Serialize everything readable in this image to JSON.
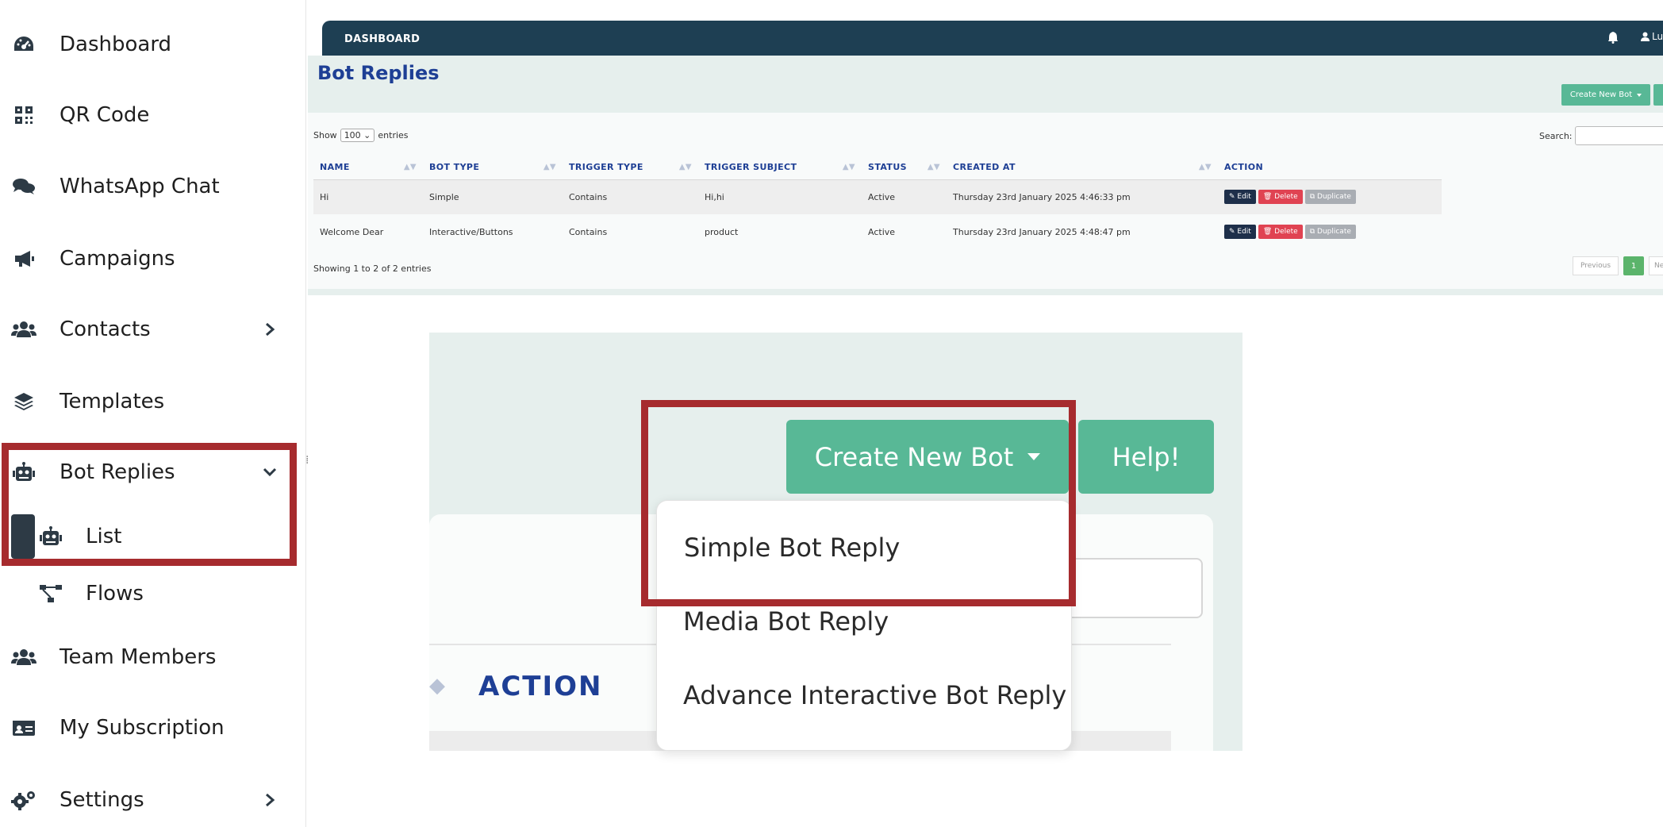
{
  "sidebar": {
    "items": [
      {
        "label": "Dashboard",
        "icon": "tachometer-icon"
      },
      {
        "label": "QR Code",
        "icon": "qrcode-icon"
      },
      {
        "label": "WhatsApp Chat",
        "icon": "comments-icon"
      },
      {
        "label": "Campaigns",
        "icon": "bullhorn-icon"
      },
      {
        "label": "Contacts",
        "icon": "users-icon"
      },
      {
        "label": "Templates",
        "icon": "layers-icon"
      },
      {
        "label": "Bot Replies",
        "icon": "robot-icon"
      },
      {
        "label": "Team Members",
        "icon": "users-icon"
      },
      {
        "label": "My Subscription",
        "icon": "id-card-icon"
      },
      {
        "label": "Settings",
        "icon": "cogs-icon"
      }
    ],
    "sub_items": [
      {
        "label": "List",
        "icon": "robot-icon"
      },
      {
        "label": "Flows",
        "icon": "sitemap-icon"
      }
    ]
  },
  "topbar": {
    "breadcrumb": "DASHBOARD",
    "user_label": "Lux"
  },
  "page": {
    "title": "Bot Replies",
    "create_button": "Create New Bot"
  },
  "table_controls": {
    "show_prefix": "Show",
    "show_value": "100",
    "show_suffix": "entries",
    "search_label": "Search:"
  },
  "table": {
    "headers": [
      "NAME",
      "BOT TYPE",
      "TRIGGER TYPE",
      "TRIGGER SUBJECT",
      "STATUS",
      "CREATED AT",
      "ACTION"
    ],
    "rows": [
      {
        "name": "Hi",
        "bot_type": "Simple",
        "trigger_type": "Contains",
        "trigger_subject": "Hi,hi",
        "status": "Active",
        "created_at": "Thursday 23rd January 2025 4:46:33 pm"
      },
      {
        "name": "Welcome Dear",
        "bot_type": "Interactive/Buttons",
        "trigger_type": "Contains",
        "trigger_subject": "product",
        "status": "Active",
        "created_at": "Thursday 23rd January 2025 4:48:47 pm"
      }
    ],
    "actions": {
      "edit": "Edit",
      "delete": "Delete",
      "duplicate": "Duplicate"
    }
  },
  "footer": {
    "showing": "Showing 1 to 2 of 2 entries",
    "prev": "Previous",
    "page": "1",
    "next": "Ne"
  },
  "zoom": {
    "create_button": "Create New Bot",
    "help_button": "Help!",
    "action_header": "ACTION",
    "dropdown": [
      "Simple Bot Reply",
      "Media Bot Reply",
      "Advance Interactive Bot Reply"
    ]
  },
  "colors": {
    "accent_green": "#58b896",
    "topbar": "#1e3f53",
    "title_blue": "#1e3f95",
    "highlight_red": "#a62b2e"
  }
}
